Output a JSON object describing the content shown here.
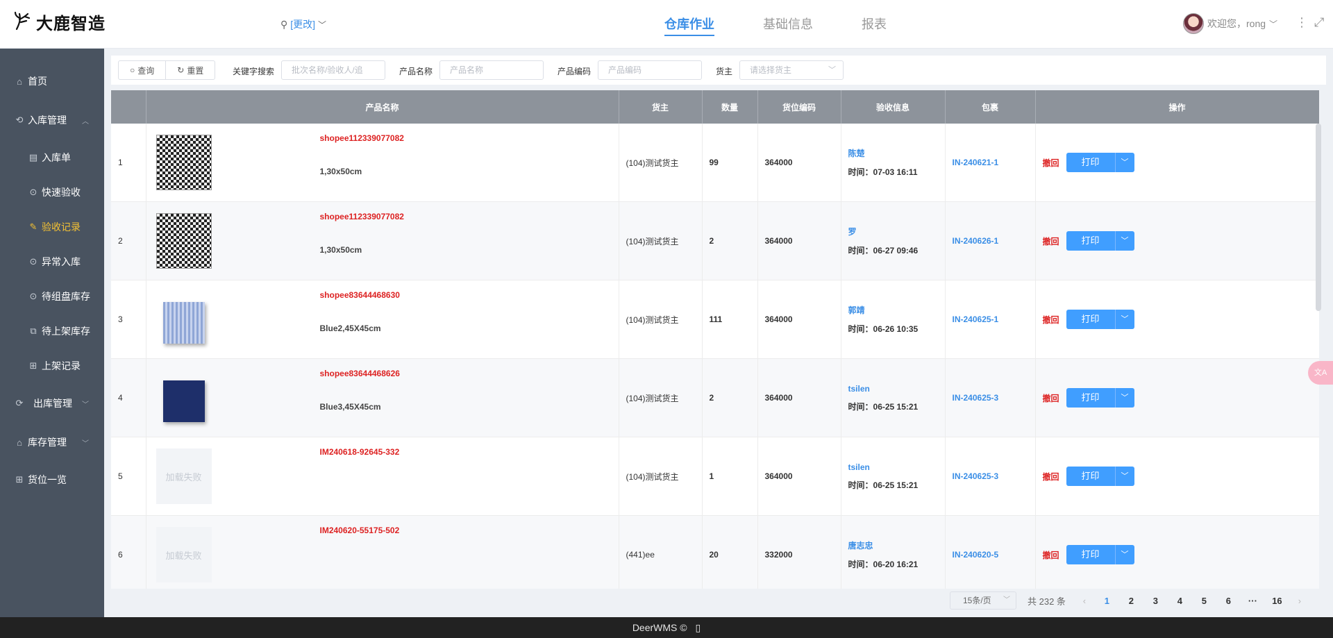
{
  "header": {
    "logo_text": "大鹿智造",
    "location_label": "[更改]",
    "tabs": [
      {
        "label": "仓库作业",
        "active": true
      },
      {
        "label": "基础信息",
        "active": false
      },
      {
        "label": "报表",
        "active": false
      }
    ],
    "user_greeting": "欢迎您，rong"
  },
  "sidebar": {
    "items": [
      {
        "label": "首页",
        "icon": "home-icon"
      },
      {
        "label": "入库管理",
        "icon": "inbound-icon"
      },
      {
        "label": "入库单",
        "icon": "document-icon"
      },
      {
        "label": "快速验收",
        "icon": "dots-circle-icon"
      },
      {
        "label": "验收记录",
        "icon": "edit-record-icon"
      },
      {
        "label": "异常入库",
        "icon": "dots-circle-icon"
      },
      {
        "label": "待组盘库存",
        "icon": "dots-circle-icon"
      },
      {
        "label": "待上架库存",
        "icon": "boxes-icon"
      },
      {
        "label": "上架记录",
        "icon": "shelf-icon"
      },
      {
        "label": "出库管理",
        "icon": "outbound-icon"
      },
      {
        "label": "库存管理",
        "icon": "stock-icon"
      },
      {
        "label": "货位一览",
        "icon": "shelf-icon"
      }
    ]
  },
  "filters": {
    "query_button": "查询",
    "reset_button": "重置",
    "keyword_label": "关键字搜索",
    "keyword_placeholder": "批次名称/验收人/追",
    "product_name_label": "产品名称",
    "product_name_placeholder": "产品名称",
    "product_code_label": "产品编码",
    "product_code_placeholder": "产品编码",
    "owner_label": "货主",
    "owner_placeholder": "请选择货主"
  },
  "table": {
    "headers": [
      "",
      "产品名称",
      "货主",
      "数量",
      "货位编码",
      "验收信息",
      "包裹",
      "操作"
    ],
    "time_prefix": "时间：",
    "undo_label": "撤回",
    "print_label": "打印",
    "image_failed_label": "加载失败",
    "rows": [
      {
        "index": "1",
        "thumb": "houndstooth",
        "product_code": "shopee112339077082",
        "spec": "1,30x50cm",
        "owner": "(104)测试货主",
        "qty": "99",
        "location": "364000",
        "receiver": "陈楚",
        "time": "07-03 16:11",
        "package": "IN-240621-1"
      },
      {
        "index": "2",
        "thumb": "houndstooth",
        "product_code": "shopee112339077082",
        "spec": "1,30x50cm",
        "owner": "(104)测试货主",
        "qty": "2",
        "location": "364000",
        "receiver": "罗",
        "time": "06-27 09:46",
        "package": "IN-240626-1"
      },
      {
        "index": "3",
        "thumb": "blue",
        "product_code": "shopee83644468630",
        "spec": "Blue2,45X45cm",
        "owner": "(104)测试货主",
        "qty": "111",
        "location": "364000",
        "receiver": "郭靖",
        "time": "06-26 10:35",
        "package": "IN-240625-1"
      },
      {
        "index": "4",
        "thumb": "navy",
        "product_code": "shopee83644468626",
        "spec": "Blue3,45X45cm",
        "owner": "(104)测试货主",
        "qty": "2",
        "location": "364000",
        "receiver": "tsilen",
        "time": "06-25 15:21",
        "package": "IN-240625-3"
      },
      {
        "index": "5",
        "thumb": "failed",
        "product_code": "IM240618-92645-332",
        "spec": "",
        "owner": "(104)测试货主",
        "qty": "1",
        "location": "364000",
        "receiver": "tsilen",
        "time": "06-25 15:21",
        "package": "IN-240625-3"
      },
      {
        "index": "6",
        "thumb": "failed",
        "product_code": "IM240620-55175-502",
        "spec": "",
        "owner": "(441)ee",
        "qty": "20",
        "location": "332000",
        "receiver": "唐志忠",
        "time": "06-20 16:21",
        "package": "IN-240620-5"
      }
    ]
  },
  "pagination": {
    "page_size": "15条/页",
    "total": "共 232 条",
    "pages": [
      "1",
      "2",
      "3",
      "4",
      "5",
      "6",
      "···",
      "16"
    ],
    "current": "1"
  },
  "footer": {
    "text": "DeerWMS ©"
  },
  "colors": {
    "accent": "#3a8ee6",
    "sidebar_bg": "#495360",
    "sidebar_active": "#f5c233",
    "product_red": "#dd2222",
    "header_gray": "#8d939b",
    "print_button": "#409eff"
  }
}
